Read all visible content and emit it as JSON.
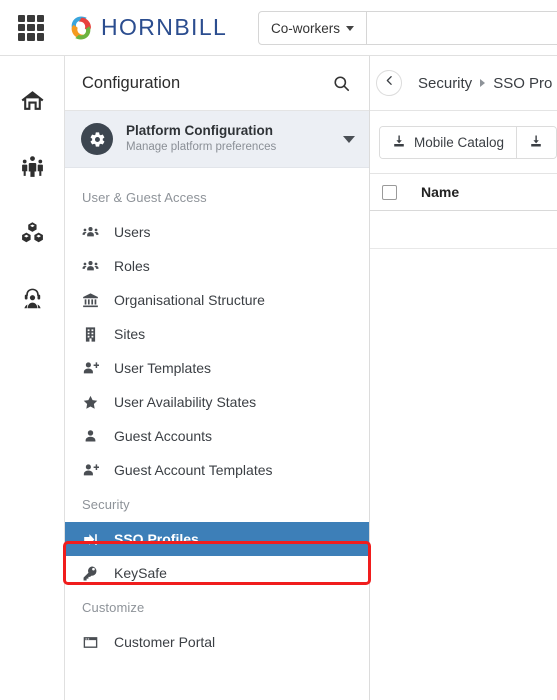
{
  "topbar": {
    "apps_icon": "grid-apps-icon",
    "brand": "HORNBILL",
    "brand_color": "#2b4d8f",
    "search": {
      "scope_label": "Co-workers",
      "scope_icon": "chevron-down-icon",
      "placeholder": "",
      "value": ""
    }
  },
  "rail": {
    "items": [
      {
        "name": "home",
        "icon": "home-icon"
      },
      {
        "name": "collaboration",
        "icon": "people-group-icon"
      },
      {
        "name": "services",
        "icon": "cubes-icon"
      },
      {
        "name": "support",
        "icon": "headset-agent-icon"
      }
    ]
  },
  "config_panel": {
    "title": "Configuration",
    "search_icon": "search-icon",
    "platform": {
      "icon": "gear-icon",
      "title": "Platform Configuration",
      "subtitle": "Manage platform preferences",
      "caret_icon": "caret-down-icon"
    },
    "sections": [
      {
        "label": "User & Guest Access",
        "items": [
          {
            "label": "Users",
            "icon": "users-group-icon",
            "active": false
          },
          {
            "label": "Roles",
            "icon": "users-group-icon",
            "active": false
          },
          {
            "label": "Organisational Structure",
            "icon": "bank-columns-icon",
            "active": false
          },
          {
            "label": "Sites",
            "icon": "building-icon",
            "active": false
          },
          {
            "label": "User Templates",
            "icon": "user-plus-icon",
            "active": false
          },
          {
            "label": "User Availability States",
            "icon": "star-icon",
            "active": false
          },
          {
            "label": "Guest Accounts",
            "icon": "user-icon",
            "active": false
          },
          {
            "label": "Guest Account Templates",
            "icon": "user-plus-icon",
            "active": false
          }
        ]
      },
      {
        "label": "Security",
        "items": [
          {
            "label": "SSO Profiles",
            "icon": "sign-in-icon",
            "active": true
          },
          {
            "label": "KeySafe",
            "icon": "key-icon",
            "active": false
          }
        ]
      },
      {
        "label": "Customize",
        "items": [
          {
            "label": "Customer Portal",
            "icon": "window-icon",
            "active": false
          }
        ]
      }
    ],
    "active_highlight_color": "#3d7fb8",
    "annotation_color": "#f01d1d"
  },
  "content": {
    "back_icon": "chevron-left-icon",
    "breadcrumb": [
      {
        "label": "Security"
      },
      {
        "label": "SSO Pro"
      }
    ],
    "breadcrumb_sep_icon": "caret-right-icon",
    "toolbar": {
      "buttons": [
        {
          "label": "Mobile Catalog",
          "icon": "download-icon"
        },
        {
          "label": "",
          "icon": "download-icon"
        }
      ]
    },
    "table": {
      "select_all_checkbox": "unchecked",
      "columns": [
        "Name"
      ]
    }
  }
}
